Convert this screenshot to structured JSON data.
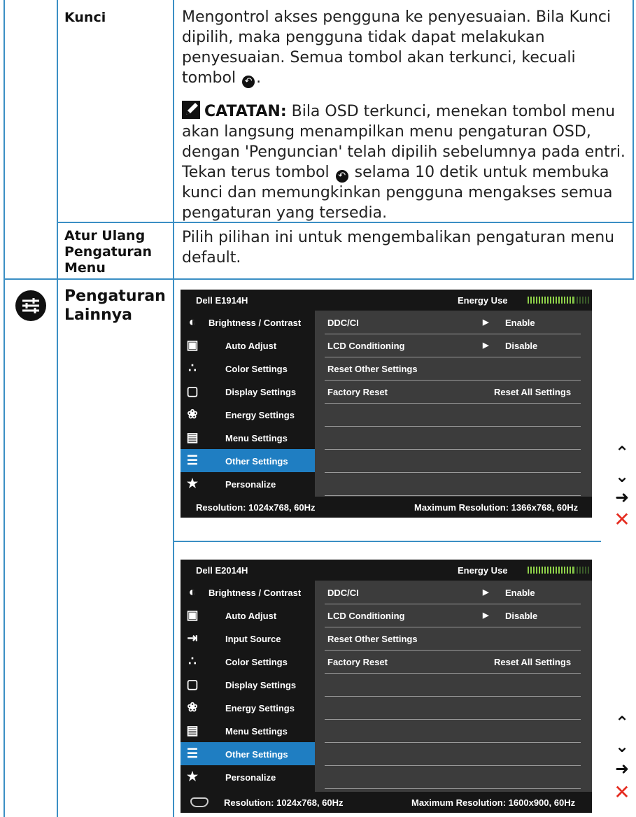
{
  "rows": [
    {
      "label": "Kunci",
      "desc_pre": "Mengontrol akses pengguna ke penyesuaian. Bila Kunci dipilih, maka pengguna tidak dapat melakukan penyesuaian. Semua tombol akan terkunci, kecuali tombol",
      "desc_post": ".",
      "note_label": "CATATAN:",
      "note_pre": " Bila OSD terkunci, menekan tombol menu akan langsung menampilkan menu pengaturan OSD, dengan 'Penguncian' telah dipilih sebelumnya pada entri. Tekan terus tombol",
      "note_post": "selama 10 detik untuk membuka kunci dan memungkinkan pengguna mengakses semua pengaturan yang tersedia."
    },
    {
      "label": "Atur Ulang Pengaturan Menu",
      "desc": "Pilih pilihan ini untuk mengembalikan pengaturan menu default."
    },
    {
      "label": "Pengaturan Lainnya"
    }
  ],
  "icons": {
    "back": "back-button-icon",
    "note": "pencil-note-icon",
    "section": "other-settings-icon"
  },
  "osd1": {
    "model": "Dell E1914H",
    "energy_label": "Energy Use",
    "menu": [
      "Brightness / Contrast",
      "Auto Adjust",
      "Color Settings",
      "Display Settings",
      "Energy Settings",
      "Menu Settings",
      "Other Settings",
      "Personalize"
    ],
    "selected": "Other Settings",
    "options": [
      {
        "name": "DDC/CI",
        "value": "Enable"
      },
      {
        "name": "LCD Conditioning",
        "value": "Disable"
      },
      {
        "name": "Reset Other Settings",
        "value": ""
      },
      {
        "name": "Factory Reset",
        "value": "Reset All Settings"
      }
    ],
    "resolution": "Resolution: 1024x768, 60Hz",
    "max_resolution": "Maximum Resolution: 1366x768, 60Hz"
  },
  "osd2": {
    "model": "Dell E2014H",
    "energy_label": "Energy Use",
    "menu": [
      "Brightness / Contrast",
      "Auto Adjust",
      "Input Source",
      "Color Settings",
      "Display Settings",
      "Energy Settings",
      "Menu Settings",
      "Other Settings",
      "Personalize"
    ],
    "selected": "Other Settings",
    "options": [
      {
        "name": "DDC/CI",
        "value": "Enable"
      },
      {
        "name": "LCD Conditioning",
        "value": "Disable"
      },
      {
        "name": "Reset Other Settings",
        "value": ""
      },
      {
        "name": "Factory Reset",
        "value": "Reset All Settings"
      }
    ],
    "resolution": "Resolution: 1024x768, 60Hz",
    "max_resolution": "Maximum Resolution: 1600x900, 60Hz"
  },
  "nav_icons": [
    "up-arrow-icon",
    "down-arrow-icon",
    "right-arrow-icon",
    "close-icon"
  ]
}
